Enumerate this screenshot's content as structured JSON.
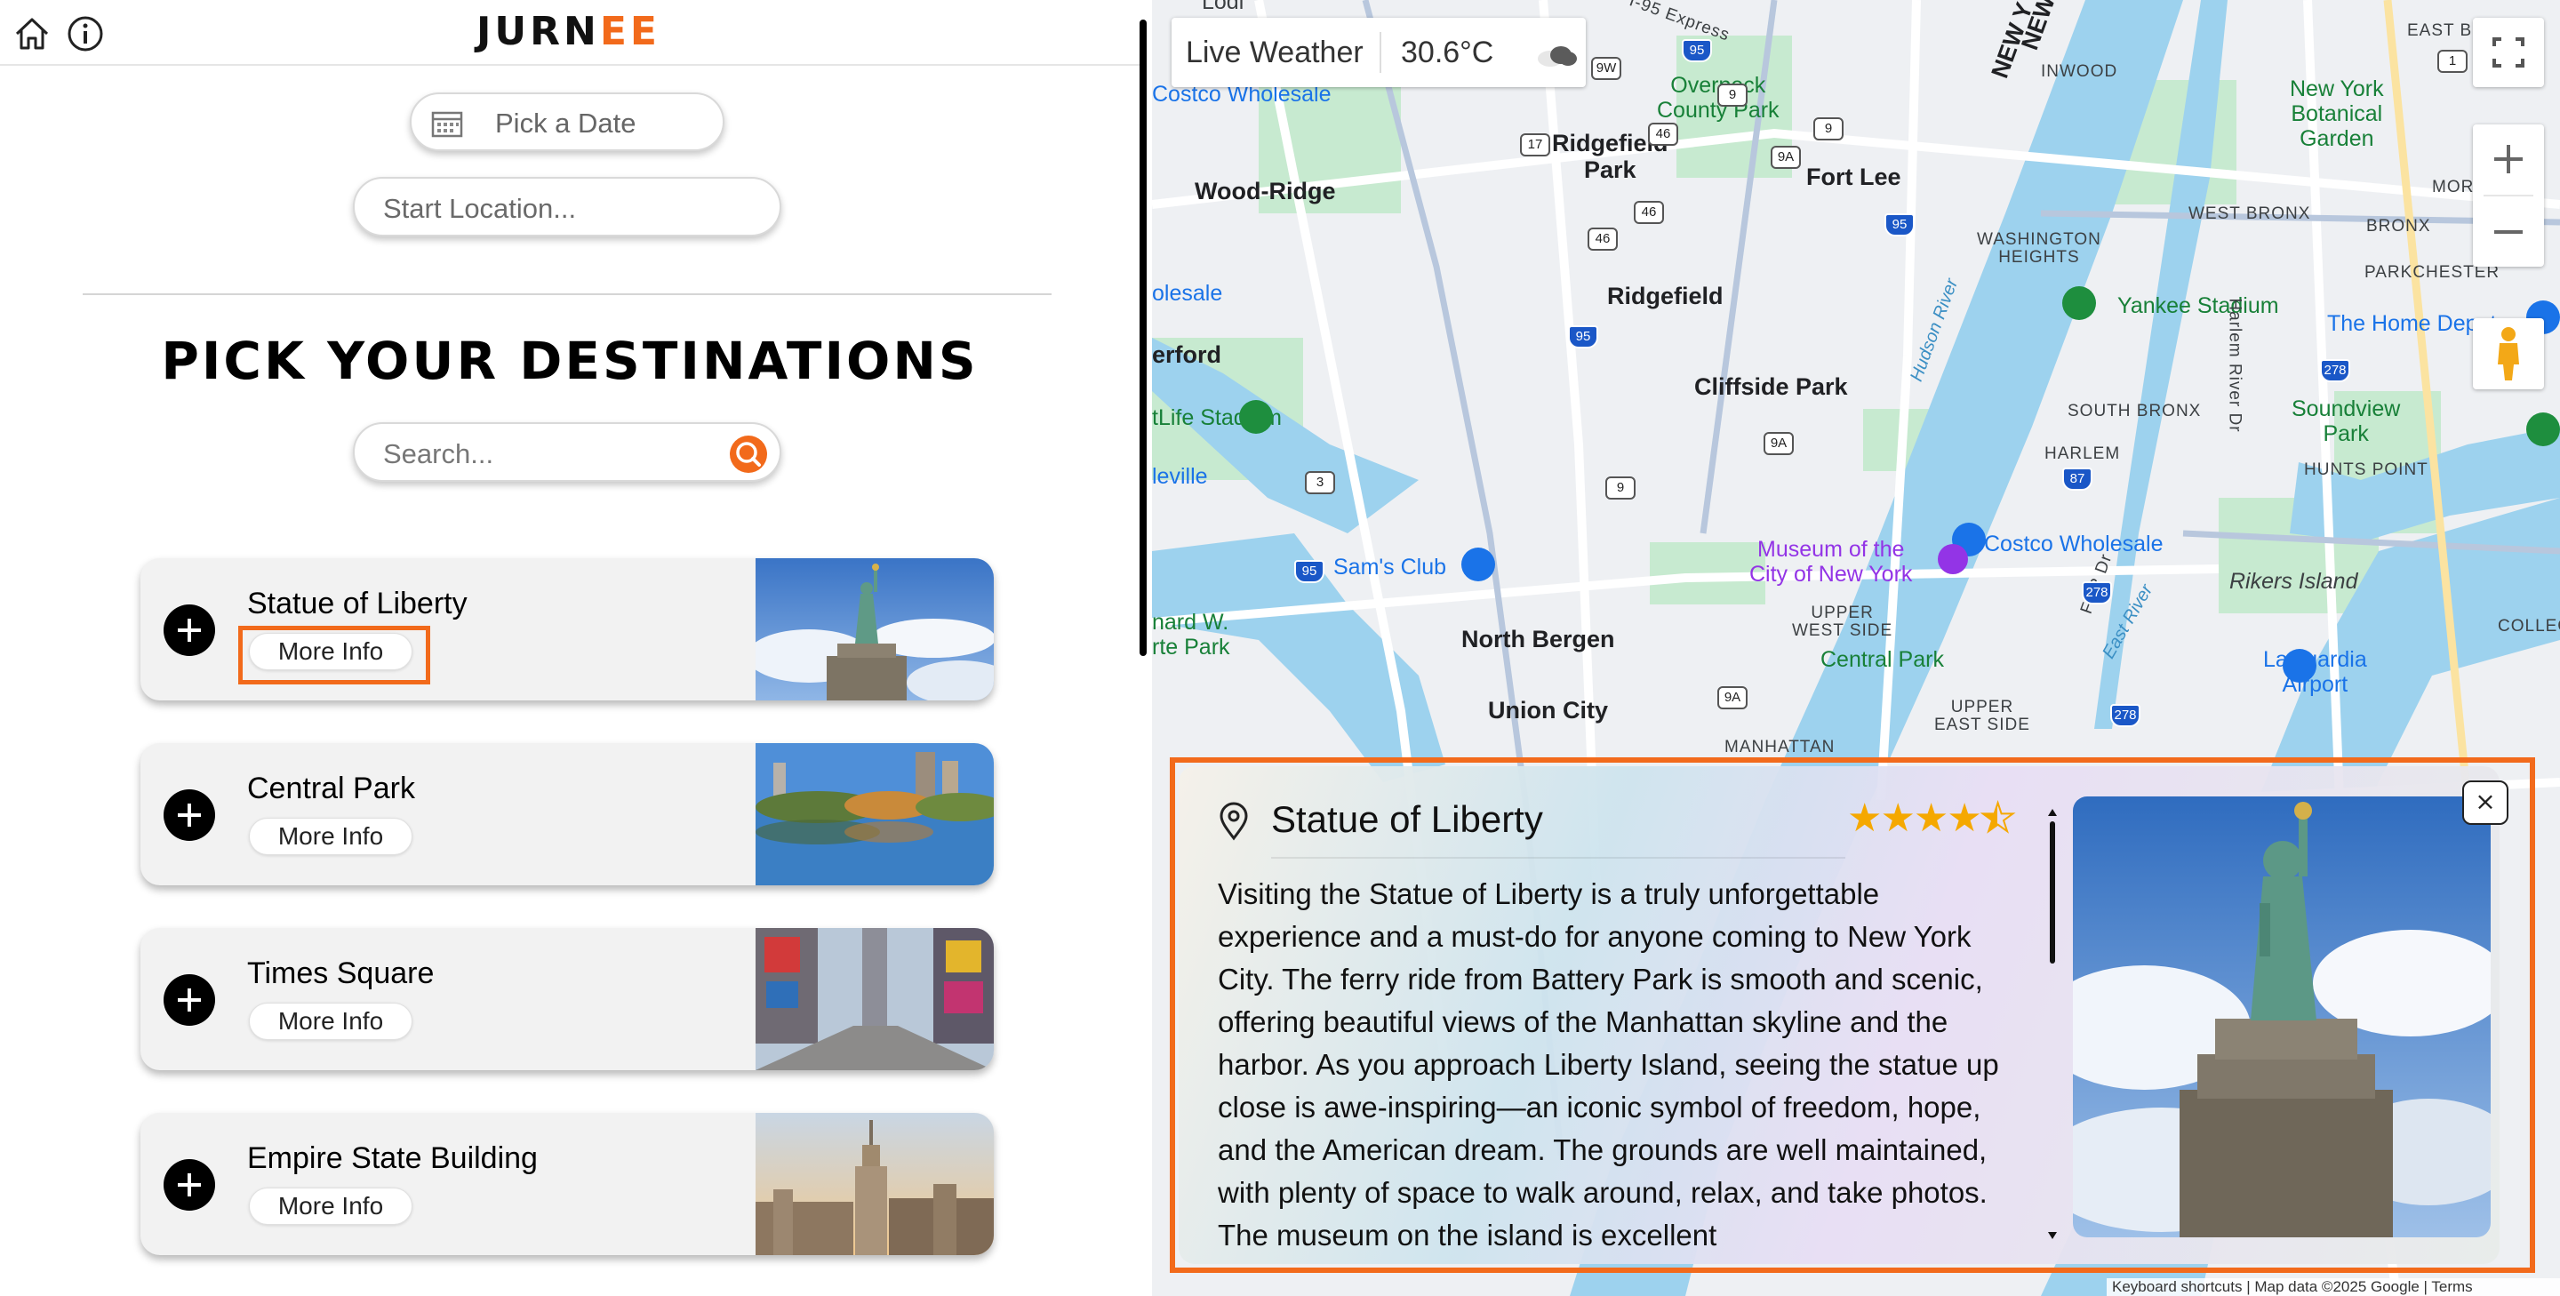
{
  "app": {
    "logo_main": "JURN",
    "logo_accent": "EE",
    "header_icons": [
      "home-icon",
      "info-icon"
    ]
  },
  "controls": {
    "date_label": "Pick a Date",
    "start_placeholder": "Start Location...",
    "section_title": "PICK YOUR DESTINATIONS",
    "search_placeholder": "Search..."
  },
  "destinations": [
    {
      "name": "Statue of Liberty",
      "more": "More Info"
    },
    {
      "name": "Central Park",
      "more": "More Info"
    },
    {
      "name": "Times Square",
      "more": "More Info"
    },
    {
      "name": "Empire State Building",
      "more": "More Info"
    }
  ],
  "weather": {
    "label": "Live Weather",
    "temp": "30.6°C",
    "icon": "cloudy-icon"
  },
  "map": {
    "labels": {
      "lodi": "Lodi",
      "costco_top": "Costco Wholesale",
      "overpeck": "Overpeck\nCounty Park",
      "ridgefield_park": "Ridgefield\nPark",
      "wood_ridge": "Wood-Ridge",
      "fort_lee": "Fort Lee",
      "ridgefield": "Ridgefield",
      "cliffside": "Cliffside Park",
      "yankee": "Yankee Stadium",
      "metlife": "tLife Stadium",
      "sams": "Sam's Club",
      "museum": "Museum of the\nCity of New York",
      "north_bergen": "North Bergen",
      "union_city": "Union City",
      "central_park": "Central Park",
      "costco_right": "Costco Wholesale",
      "rikers": "Rikers Island",
      "laguardia": "LaGuardia\nAirport",
      "home_depot": "The Home Depot",
      "soundview": "Soundview\nPark",
      "botanical": "New York\nBotanical\nGarden",
      "inwood": "INWOOD",
      "west_bronx": "WEST BRONX",
      "washington_heights": "WASHINGTON\nHEIGHTS",
      "parkchester": "PARKCHESTER",
      "bronx": "BRONX",
      "south_bronx": "SOUTH BRONX",
      "harlem": "HARLEM",
      "hunts_point": "HUNTS POINT",
      "upper_west": "UPPER\nWEST SIDE",
      "upper_east": "UPPER\nEAST SIDE",
      "manhattan": "MANHATTAN",
      "college": "COLLEGE",
      "east_bronx": "EAST B",
      "morris": "MORRI",
      "hudson": "Hudson River",
      "harlem_river": "Harlem River Dr",
      "east_river": "East River",
      "fdr": "FDR Dr",
      "i95_express": "I-95 Express",
      "sale": "olesale",
      "erford": "erford",
      "leville": "leville",
      "nard": "nard W.\nrte Park",
      "newyork1": "NEW Y",
      "newyork2": "NEW"
    },
    "credits": "Keyboard shortcuts   |   Map data ©2025 Google   |   Terms"
  },
  "info_panel": {
    "title": "Statue of Liberty",
    "rating": 4.5,
    "description": "Visiting the Statue of Liberty is a truly unforgettable experience and a must-do for anyone coming to New York City. The ferry ride from Battery Park is smooth and scenic, offering beautiful views of the Manhattan skyline and the harbor. As you approach Liberty Island, seeing the statue up close is awe-inspiring—an iconic symbol of freedom, hope, and the American dream. The grounds are well maintained, with plenty of space to walk around, relax, and take photos. The museum on the island is excellent",
    "close_label": "×"
  },
  "colors": {
    "accent": "#f26a1b",
    "star": "#f5a800"
  }
}
